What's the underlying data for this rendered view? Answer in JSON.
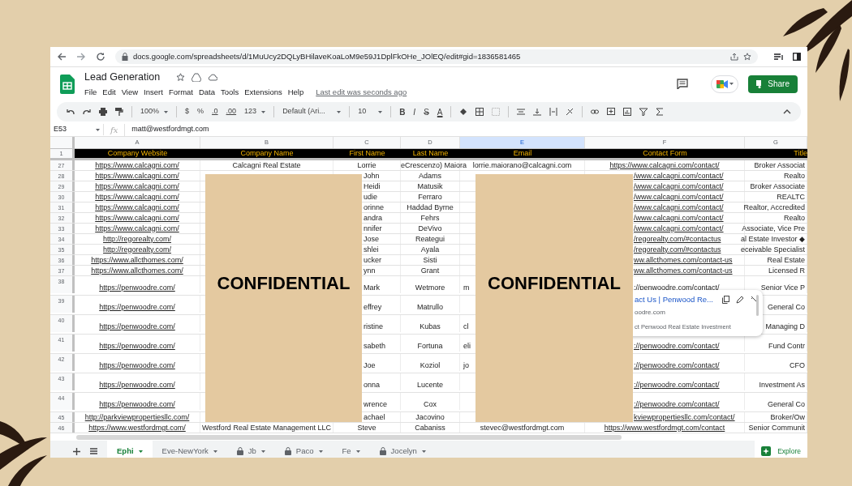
{
  "browser": {
    "url": "docs.google.com/spreadsheets/d/1MuUcy2DQLyBHilaveKoaLoM9e59J1DplFkOHe_JOlEQ/edit#gid=1836581465"
  },
  "document": {
    "title": "Lead Generation",
    "menu": [
      "File",
      "Edit",
      "View",
      "Insert",
      "Format",
      "Data",
      "Tools",
      "Extensions",
      "Help"
    ],
    "last_edit": "Last edit was seconds ago",
    "share_button": "Share"
  },
  "toolbar": {
    "zoom": "100%",
    "currency": "$",
    "percent": "%",
    "decrease_decimals": ".0",
    "increase_decimals": ".00",
    "number_format": "123",
    "font": "Default (Ari...",
    "font_size": "10",
    "bold": "B",
    "italic": "I",
    "strikethrough": "S",
    "text_color": "A"
  },
  "formula_bar": {
    "cell": "E53",
    "label": "fx",
    "value": "matt@westfordmgt.com"
  },
  "header_row": "1",
  "columns": [
    {
      "letter": "A",
      "heading": "Company Website",
      "selected": false
    },
    {
      "letter": "B",
      "heading": "Company Name",
      "selected": false
    },
    {
      "letter": "C",
      "heading": "First Name",
      "selected": false
    },
    {
      "letter": "D",
      "heading": "Last Name",
      "selected": false
    },
    {
      "letter": "E",
      "heading": "Email",
      "selected": true
    },
    {
      "letter": "F",
      "heading": "Contact Form",
      "selected": false
    },
    {
      "letter": "G",
      "heading": "Title",
      "selected": false
    }
  ],
  "rows": [
    {
      "number": "27",
      "kind": "normal",
      "website": "https://www.calcagni.com/",
      "company": "Calcagni Real Estate",
      "first_name": "Lorrie",
      "last_name": "eCrescenzo) Maiora",
      "email": "lorrie.maiorano@calcagni.com",
      "contact_form": "https://www.calcagni.com/contact/",
      "title": "Broker Associat"
    },
    {
      "number": "28",
      "kind": "normal",
      "website": "https://www.calcagni.com/",
      "first_name": "John",
      "last_name": "Adams",
      "contact_form": "/www.calcagni.com/contact/",
      "title": "Realto"
    },
    {
      "number": "29",
      "kind": "normal",
      "website": "https://www.calcagni.com/",
      "first_name": "Heidi",
      "last_name": "Matusik",
      "contact_form": "/www.calcagni.com/contact/",
      "title": "Broker Associate"
    },
    {
      "number": "30",
      "kind": "normal",
      "website": "https://www.calcagni.com/",
      "first_name": "udie",
      "last_name": "Ferraro",
      "contact_form": "/www.calcagni.com/contact/",
      "title": "REALTC"
    },
    {
      "number": "31",
      "kind": "normal",
      "website": "https://www.calcagni.com/",
      "first_name": "orinne",
      "last_name": "Haddad Byrne",
      "contact_form": "/www.calcagni.com/contact/",
      "title": "Realtor, Accredited"
    },
    {
      "number": "32",
      "kind": "normal",
      "website": "https://www.calcagni.com/",
      "first_name": "andra",
      "last_name": "Fehrs",
      "contact_form": "/www.calcagni.com/contact/",
      "title": "Realto"
    },
    {
      "number": "33",
      "kind": "normal",
      "website": "https://www.calcagni.com/",
      "first_name": "nnifer",
      "last_name": "DeVivo",
      "contact_form": "/www.calcagni.com/contact/",
      "title": "Associate, Vice Pre"
    },
    {
      "number": "34",
      "kind": "normal",
      "website": "http://regorealty.com/",
      "first_name": "Jose",
      "last_name": "Reategui",
      "contact_form": "/regorealty.com/#contactus",
      "title": "al Estate Investor ◆"
    },
    {
      "number": "35",
      "kind": "normal",
      "website": "http://regorealty.com/",
      "first_name": "shlei",
      "last_name": "Ayala",
      "contact_form": "/regorealty.com/#contactus",
      "title": "eceivable Specialist"
    },
    {
      "number": "36",
      "kind": "normal",
      "website": "https://www.allcthomes.com/",
      "first_name": "ucker",
      "last_name": "Sisti",
      "contact_form": "ww.allcthomes.com/contact-us",
      "title": "Real Estate"
    },
    {
      "number": "37",
      "kind": "normal",
      "website": "https://www.allcthomes.com/",
      "first_name": "ynn",
      "last_name": "Grant",
      "contact_form": "ww.allcthomes.com/contact-us",
      "title": "Licensed R"
    },
    {
      "number": "38",
      "kind": "tall",
      "website": "https://penwoodre.com/",
      "first_name": "Mark",
      "last_name": "Wetmore",
      "email": "m",
      "contact_form": "://penwoodre.com/contact/",
      "title": "Senior Vice P"
    },
    {
      "number": "39",
      "kind": "tall",
      "website": "https://penwoodre.com/",
      "first_name": "effrey",
      "last_name": "Matrullo",
      "title": "General Co"
    },
    {
      "number": "40",
      "kind": "tall",
      "website": "https://penwoodre.com/",
      "first_name": "ristine",
      "last_name": "Kubas",
      "email": "cl",
      "title": "Managing D"
    },
    {
      "number": "41",
      "kind": "tall",
      "website": "https://penwoodre.com/",
      "first_name": "sabeth",
      "last_name": "Fortuna",
      "email": "eli",
      "contact_form": "://penwoodre.com/contact/",
      "title": "Fund Contr"
    },
    {
      "number": "42",
      "kind": "tall",
      "website": "https://penwoodre.com/",
      "first_name": "Joe",
      "last_name": "Koziol",
      "email": "jo",
      "contact_form": "://penwoodre.com/contact/",
      "title": "CFO"
    },
    {
      "number": "43",
      "kind": "tall",
      "website": "https://penwoodre.com/",
      "first_name": "onna",
      "last_name": "Lucente",
      "contact_form": "://penwoodre.com/contact/",
      "title": "Investment As"
    },
    {
      "number": "44",
      "kind": "tall",
      "website": "https://penwoodre.com/",
      "first_name": "wrence",
      "last_name": "Cox",
      "contact_form": "://penwoodre.com/contact/",
      "title": "General Co"
    },
    {
      "number": "45",
      "kind": "normal",
      "website": "http://parkviewpropertiesllc.com/",
      "first_name": "achael",
      "last_name": "Jacovino",
      "contact_form": "kviewpropertiesllc.com/contact/",
      "title": "Broker/Ow"
    },
    {
      "number": "46",
      "kind": "normal",
      "website": "https://www.westfordmgt.com/",
      "company": "Westford Real Estate Management LLC",
      "first_name": "Steve",
      "last_name": "Cabaniss",
      "email": "stevec@westfordmgt.com",
      "contact_form": "https://www.westfordmgt.com/contact",
      "title": "Senior Communit"
    }
  ],
  "redactions": [
    {
      "label": "CONFIDENTIAL"
    },
    {
      "label": "CONFIDENTIAL"
    }
  ],
  "link_preview": {
    "title": "act Us | Penwood Re...",
    "domain": "oodre.com",
    "description": "ct Penwood Real Estate Investment"
  },
  "sheet_tabs": [
    {
      "label": "Ephi",
      "selected": true,
      "locked": false
    },
    {
      "label": "Eve-NewYork",
      "selected": false,
      "locked": false
    },
    {
      "label": "Jb",
      "selected": false,
      "locked": true
    },
    {
      "label": "Paco",
      "selected": false,
      "locked": true
    },
    {
      "label": "Fe",
      "selected": false,
      "locked": false
    },
    {
      "label": "Jocelyn",
      "selected": false,
      "locked": true
    }
  ],
  "explore_button": "Explore"
}
